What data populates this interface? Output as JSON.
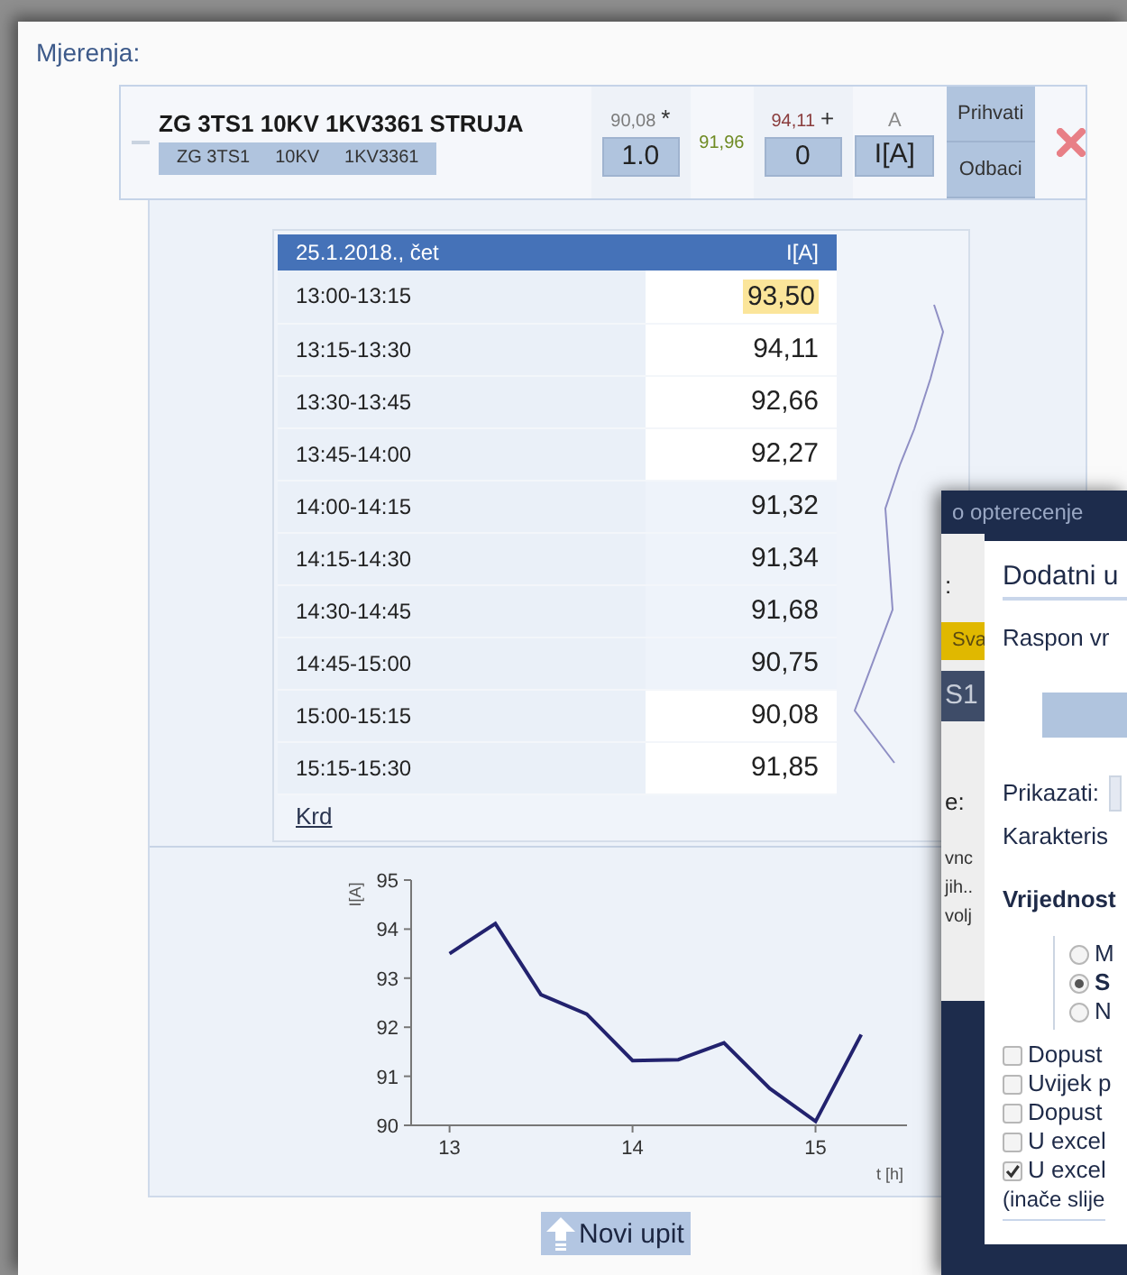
{
  "section_label": "Mjerenja:",
  "measurement": {
    "title": "ZG 3TS1 10KV 1KV3361 STRUJA",
    "tags": [
      "ZG 3TS1",
      "10KV",
      "1KV3361"
    ],
    "min": {
      "reading": "90,08",
      "marker": "*",
      "value": "1.0"
    },
    "average": "91,96",
    "max": {
      "reading": "94,11",
      "marker": "+",
      "value": "0"
    },
    "unit": {
      "label": "A",
      "value": "I[A]"
    },
    "buttons": [
      "Prihvati",
      "Odbaci"
    ]
  },
  "table": {
    "columns": [
      "25.1.2018., čet",
      "I[A]"
    ],
    "rows": [
      {
        "time": "13:00-13:15",
        "value": "93,50",
        "highlighted": true,
        "shaded": false
      },
      {
        "time": "13:15-13:30",
        "value": "94,11",
        "highlighted": false,
        "shaded": false
      },
      {
        "time": "13:30-13:45",
        "value": "92,66",
        "highlighted": false,
        "shaded": false
      },
      {
        "time": "13:45-14:00",
        "value": "92,27",
        "highlighted": false,
        "shaded": false
      },
      {
        "time": "14:00-14:15",
        "value": "91,32",
        "highlighted": false,
        "shaded": true
      },
      {
        "time": "14:15-14:30",
        "value": "91,34",
        "highlighted": false,
        "shaded": true
      },
      {
        "time": "14:30-14:45",
        "value": "91,68",
        "highlighted": false,
        "shaded": true
      },
      {
        "time": "14:45-15:00",
        "value": "90,75",
        "highlighted": false,
        "shaded": true
      },
      {
        "time": "15:00-15:15",
        "value": "90,08",
        "highlighted": false,
        "shaded": false
      },
      {
        "time": "15:15-15:30",
        "value": "91,85",
        "highlighted": false,
        "shaded": false
      }
    ],
    "link": "Krd"
  },
  "chart": {
    "chart_data": {
      "type": "line",
      "xlabel": "t [h]",
      "ylabel": "I[A]",
      "x": [
        13,
        13.25,
        13.5,
        13.75,
        14,
        14.25,
        14.5,
        14.75,
        15,
        15.25
      ],
      "series": [
        {
          "color": "#22226e",
          "values": [
            93.5,
            94.11,
            92.66,
            92.27,
            91.32,
            91.34,
            91.68,
            90.75,
            90.08,
            91.85
          ]
        }
      ],
      "xlim": [
        12.79,
        15.5
      ],
      "ylim": [
        90,
        95
      ],
      "xticks": [
        13,
        14,
        15
      ],
      "yticks": [
        90,
        91,
        92,
        93,
        94,
        95
      ]
    }
  },
  "new_query_button": "Novi upit",
  "background_window": {
    "title": "o opterecenje",
    "fragments": [
      {
        "kind": "text",
        "text": ":"
      },
      {
        "kind": "badge",
        "text": "Sva"
      },
      {
        "kind": "bar",
        "text": "S1"
      },
      {
        "kind": "text",
        "text": "e:"
      },
      {
        "kind": "small",
        "text": "vnc"
      },
      {
        "kind": "small",
        "text": "jih.."
      },
      {
        "kind": "small",
        "text": "volj"
      }
    ]
  },
  "dialog": {
    "title": "Dodatni u",
    "range_label": "Raspon vr",
    "show_label": "Prikazati:",
    "characteristic_label": "Karakteris",
    "values_label": "Vrijednost",
    "radios": [
      {
        "label": "M",
        "selected": false
      },
      {
        "label": "S",
        "selected": true
      },
      {
        "label": "N",
        "selected": false
      }
    ],
    "checkboxes": [
      {
        "label": "Dopust",
        "checked": false
      },
      {
        "label": "Uvijek p",
        "checked": false
      },
      {
        "label": "Dopust",
        "checked": false
      },
      {
        "label": "U excel",
        "checked": false
      },
      {
        "label": "U excel",
        "checked": true
      }
    ],
    "note": "(inače slije"
  }
}
